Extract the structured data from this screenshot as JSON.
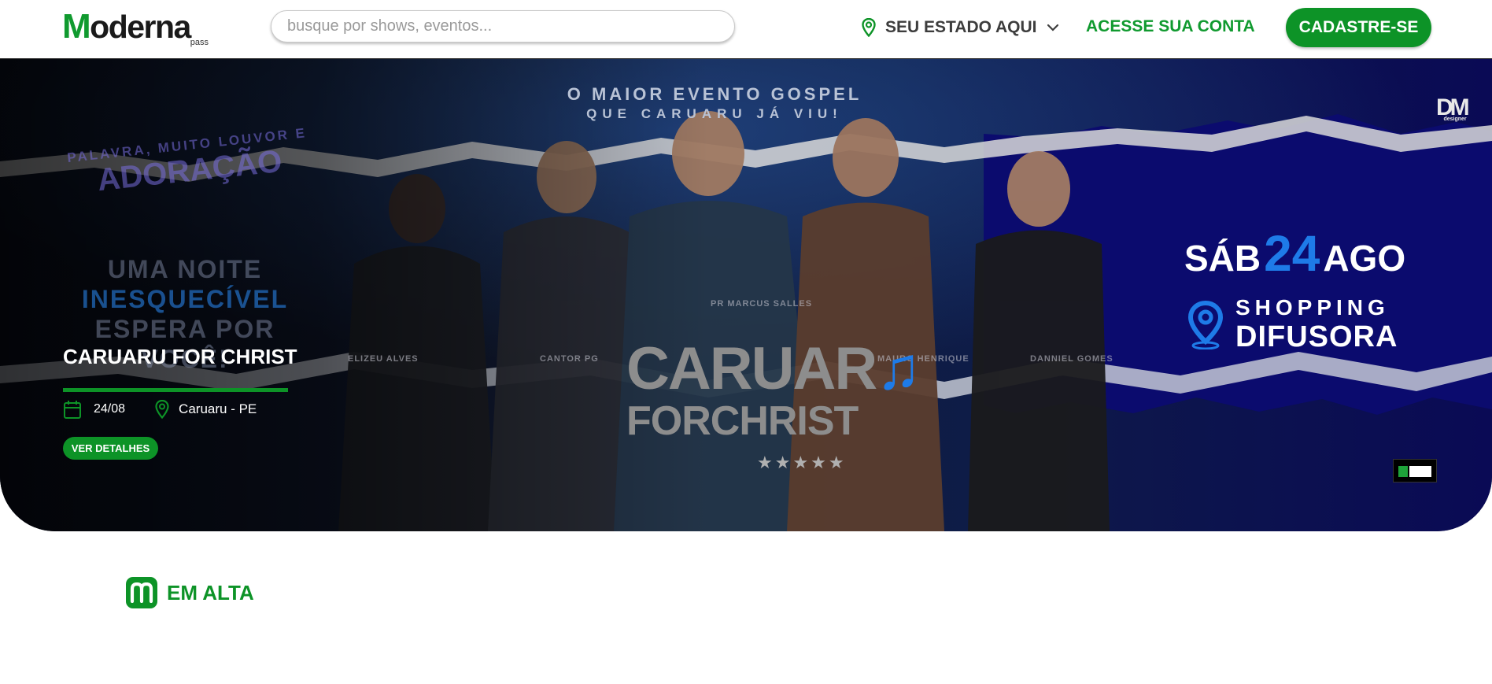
{
  "header": {
    "logo_text": "Moderna",
    "logo_sub": "pass",
    "search_placeholder": "busque por shows, eventos...",
    "state_label": "SEU ESTADO AQUI",
    "login_label": "ACESSE SUA CONTA",
    "signup_label": "CADASTRE-SE"
  },
  "hero": {
    "banner_text": {
      "top_line1": "O MAIOR EVENTO GOSPEL",
      "top_line2": "QUE CARUARU JÁ VIU!",
      "tagline1": "PALAVRA, MUITO LOUVOR E",
      "tagline2": "ADORAÇÃO",
      "noite1": "UMA NOITE",
      "noite2": "INESQUECÍVEL",
      "noite3": "ESPERA POR",
      "noite4": "VOCÊ!",
      "artists": [
        "ELIZEU ALVES",
        "CANTOR PG",
        "PR MARCUS SALLES",
        "MAURO HENRIQUE",
        "DANNIEL GOMES"
      ],
      "brand_line1": "CARUAR",
      "brand_line2": "FORCHRIST",
      "stars": "★★★★★",
      "date_dow": "SÁB",
      "date_day": "24",
      "date_month": "AGO",
      "venue_line1": "SHOPPING",
      "venue_line2": "DIFUSORA",
      "designer_mark": "DM",
      "designer_sub": "designer"
    },
    "event": {
      "title": "CARUARU FOR CHRIST",
      "date": "24/08",
      "location": "Caruaru - PE",
      "details_label": "VER DETALHES"
    }
  },
  "trending": {
    "label": "EM ALTA"
  },
  "colors": {
    "brand_green": "#0d9327",
    "header_bg": "#ffffff",
    "date_accent": "#1e7be8"
  }
}
